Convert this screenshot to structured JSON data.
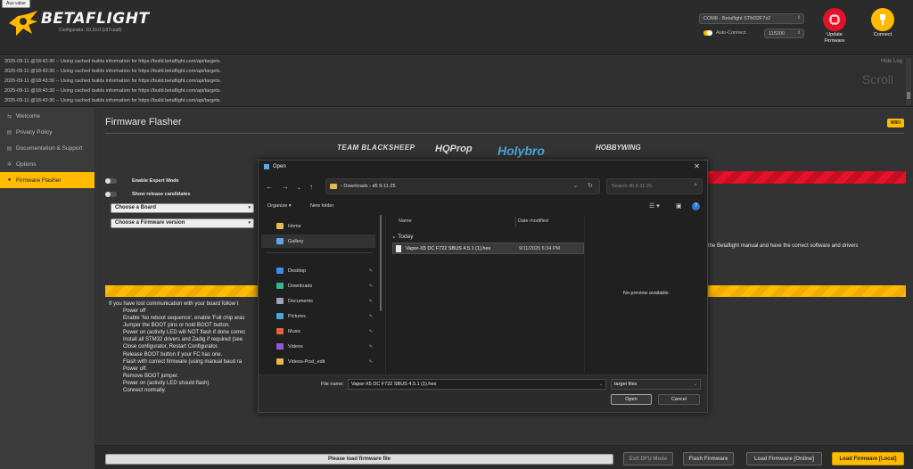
{
  "header": {
    "aux_badge": "Aux value",
    "logo_text": "BETAFLIGHT",
    "logo_sub": "Configurator: 10.10.0 (c97cea8)",
    "port": "COM8 - Betaflight STM32F7x2",
    "auto_connect": "Auto-Connect",
    "baud": "115200",
    "update_label_1": "Update",
    "update_label_2": "Firmware",
    "connect_label": "Connect"
  },
  "log": {
    "lines": [
      "2025-09-11 @18:43:30 -- Using cached builds information for https://build.betaflight.com/api/targets.",
      "2025-09-11 @18:43:30 -- Using cached builds information for https://build.betaflight.com/api/targets.",
      "2025-09-11 @18:43:30 -- Using cached builds information for https://build.betaflight.com/api/targets.",
      "2025-09-11 @18:43:30 -- Using cached builds information for https://build.betaflight.com/api/targets.",
      "2025-09-11 @18:43:30 -- Using cached builds information for https://build.betaflight.com/api/targets."
    ],
    "hide_log": "Hide Log",
    "scroll_watermark": "Scroll"
  },
  "sidebar": {
    "items": [
      {
        "label": "Welcome",
        "icon": "welcome-icon"
      },
      {
        "label": "Privacy Policy",
        "icon": "document-icon"
      },
      {
        "label": "Documentation & Support",
        "icon": "document-icon"
      },
      {
        "label": "Options",
        "icon": "gear-icon"
      },
      {
        "label": "Firmware Flasher",
        "icon": "flash-icon"
      }
    ]
  },
  "main": {
    "title": "Firmware Flasher",
    "wiki": "WIKI",
    "sponsors": [
      "TEAM BLACKSHEEP",
      "HQProp",
      "Holybro",
      "HOBBYWING"
    ],
    "expert_mode": "Enable Expert Mode",
    "release_candidates": "Show release candidates",
    "board_select": "Choose a Board",
    "firmware_select": "Choose a Firmware version",
    "manual_text": "the Betaflight manual and have the correct software and drivers",
    "recovery_intro": "If you have lost communication with your board follow t",
    "recovery_steps": [
      "Power off",
      "Enable 'No reboot sequence', enable 'Full chip eras",
      "Jumper the BOOT pins or hold BOOT button.",
      "Power on (activity LED will NOT flash if done correc",
      "Install all STM32 drivers and Zadig if required (see",
      "Close configurator, Restart Configurator.",
      "Release BOOT button if your FC has one.",
      "Flash with correct firmware (using manual baud ra",
      "Power off.",
      "Remove BOOT jumper.",
      "Power on (activity LED should flash).",
      "Connect normally."
    ]
  },
  "footer": {
    "progress": "Please load firmware file",
    "exit_dfu": "Exit DFU Mode",
    "flash": "Flash Firmware",
    "load_online": "Load Firmware [Online]",
    "load_local": "Load Firmware [Local]"
  },
  "dialog": {
    "title": "Open",
    "address_root": "›  Downloads  ›  d5 9-11-25",
    "search_placeholder": "Search d5 9-11-25",
    "organize": "Organize ▾",
    "new_folder": "New folder",
    "nav_items": [
      {
        "label": "Home",
        "icon": "home-icon",
        "color": "#e8b84a",
        "pinned": false
      },
      {
        "label": "Gallery",
        "icon": "gallery-icon",
        "color": "#5da7e8",
        "pinned": false
      },
      {
        "label": "Desktop",
        "icon": "desktop-icon",
        "color": "#3a8ee6",
        "pinned": true
      },
      {
        "label": "Downloads",
        "icon": "download-icon",
        "color": "#2fb68e",
        "pinned": true
      },
      {
        "label": "Documents",
        "icon": "documents-icon",
        "color": "#9aa4b2",
        "pinned": true
      },
      {
        "label": "Pictures",
        "icon": "pictures-icon",
        "color": "#4aa5d8",
        "pinned": true
      },
      {
        "label": "Music",
        "icon": "music-icon",
        "color": "#e2643a",
        "pinned": true
      },
      {
        "label": "Videos",
        "icon": "videos-icon",
        "color": "#8e5ad8",
        "pinned": true
      },
      {
        "label": "Videos-Post_edit",
        "icon": "folder-icon",
        "color": "#e8b84a",
        "pinned": true
      }
    ],
    "col_name": "Name",
    "col_date": "Date modified",
    "group": "Today",
    "file_name": "Vapor-X5 DC F722 SBUS 4.5.1 (1).hex",
    "file_date": "9/11/2025 6:34 PM",
    "preview": "No preview available.",
    "file_name_label": "File name:",
    "file_name_value": "Vapor-X5 DC F722 SBUS 4.5.1 (1).hex",
    "file_type": "target files",
    "open": "Open",
    "cancel": "Cancel"
  },
  "colors": {
    "accent": "#ffbb00",
    "danger": "#e2122a"
  }
}
